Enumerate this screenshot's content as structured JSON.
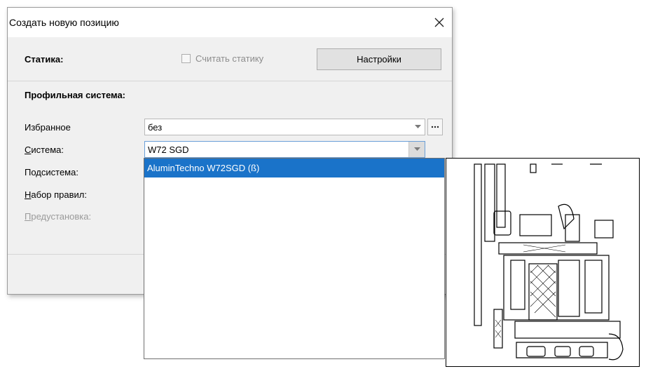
{
  "dialog": {
    "title": "Создать новую позицию"
  },
  "statics": {
    "label": "Статика:",
    "checkbox_label": "Считать статику",
    "checkbox_checked": false,
    "settings_button": "Настройки"
  },
  "profile": {
    "section_title": "Профильная система:",
    "favorites_label": "Избранное",
    "favorites_value": "без",
    "system_label_prefix": "С",
    "system_label_rest": "истема:",
    "system_value": "W72 SGD",
    "subsystem_label": "Подсистема:",
    "ruleset_label_prefix": "Н",
    "ruleset_label_rest": "абор правил:",
    "preset_label_prefix": "П",
    "preset_label_rest": "редустановка:"
  },
  "dropdown": {
    "items": [
      {
        "label": "AluminTechno W72SGD (ß)",
        "selected": true
      }
    ]
  },
  "colors": {
    "selection": "#1a73c9",
    "dialog_bg": "#f0f0f0"
  }
}
